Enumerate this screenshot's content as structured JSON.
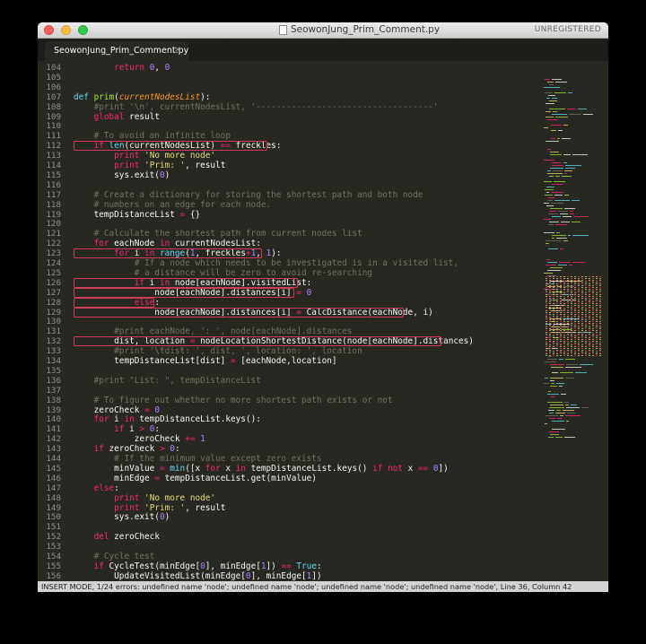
{
  "window": {
    "title": "SeowonJung_Prim_Comment.py",
    "unregistered_label": "UNREGISTERED",
    "tab_label": "SeowonJung_Prim_Comment.py",
    "tab_close_glyph": "×"
  },
  "colors": {
    "background": "#272822",
    "keyword": "#f92672",
    "function": "#a6e22e",
    "string": "#e6db74",
    "number": "#ae81ff",
    "comment": "#75715e",
    "builtin": "#66d9ef",
    "parameter": "#fd971f",
    "error_outline": "#d03a5c"
  },
  "editor": {
    "lines": [
      {
        "n": "104",
        "html": "        <span class='kw'>return</span> <span class='nm'>0</span>, <span class='nm'>0</span>"
      },
      {
        "n": "105",
        "html": ""
      },
      {
        "n": "106",
        "html": ""
      },
      {
        "n": "107",
        "html": "<span class='bi'>def</span> <span class='fn'>prim</span>(<span class='pa'>currentNodesList</span>):"
      },
      {
        "n": "108",
        "html": "    <span class='cm'>#print '\\n', currentNodesList, '-----------------------------------'</span>"
      },
      {
        "n": "109",
        "html": "    <span class='kw'>global</span> result"
      },
      {
        "n": "110",
        "html": ""
      },
      {
        "n": "111",
        "html": "    <span class='cm'># To avoid an infinite loop</span>"
      },
      {
        "n": "112",
        "html": "    <span class='kw'>if</span> <span class='bi'>len</span>(currentNodesList) <span class='kw'>==</span> freckles:"
      },
      {
        "n": "113",
        "html": "        <span class='kw'>print</span> <span class='st'>'No more node'</span>"
      },
      {
        "n": "114",
        "html": "        <span class='kw'>print</span> <span class='st'>'Prim: '</span>, result"
      },
      {
        "n": "115",
        "html": "        sys.exit(<span class='nm'>0</span>)"
      },
      {
        "n": "116",
        "html": ""
      },
      {
        "n": "117",
        "html": "    <span class='cm'># Create a dictionary for storing the shortest path and both node</span>"
      },
      {
        "n": "118",
        "html": "    <span class='cm'># numbers on an edge for each node.</span>"
      },
      {
        "n": "119",
        "html": "    tempDistanceList <span class='kw'>=</span> {}"
      },
      {
        "n": "120",
        "html": ""
      },
      {
        "n": "121",
        "html": "    <span class='cm'># Calculate the shortest path from current nodes list</span>"
      },
      {
        "n": "122",
        "html": "    <span class='kw'>for</span> eachNode <span class='kw'>in</span> currentNodesList:"
      },
      {
        "n": "123",
        "html": "        <span class='kw'>for</span> i <span class='kw'>in</span> <span class='bi'>range</span>(<span class='nm'>1</span>, freckles<span class='kw'>+</span><span class='nm'>1</span>, <span class='nm'>1</span>):"
      },
      {
        "n": "124",
        "html": "            <span class='cm'># If a node which needs to be investigated is in a visited list,</span>"
      },
      {
        "n": "125",
        "html": "            <span class='cm'># a distance will be zero to avoid re-searching</span>"
      },
      {
        "n": "126",
        "html": "            <span class='kw'>if</span> i <span class='kw'>in</span> node[eachNode].visitedList:"
      },
      {
        "n": "127",
        "html": "                node[eachNode].distances[i] <span class='kw'>=</span> <span class='nm'>0</span>"
      },
      {
        "n": "128",
        "html": "            <span class='kw'>else</span>:"
      },
      {
        "n": "129",
        "html": "                node[eachNode].distances[i] <span class='kw'>=</span> CalcDistance(eachNode, i)"
      },
      {
        "n": "130",
        "html": ""
      },
      {
        "n": "131",
        "html": "        <span class='cm'>#print eachNode, ': ', node[eachNode].distances</span>"
      },
      {
        "n": "132",
        "html": "        dist, location <span class='kw'>=</span> nodeLocationShortestDistance(node[eachNode].distances)"
      },
      {
        "n": "133",
        "html": "        <span class='cm'>#print '\\tdist: ', dist, ', location: ', location</span>"
      },
      {
        "n": "134",
        "html": "        tempDistanceList[dist] <span class='kw'>=</span> [eachNode,location]"
      },
      {
        "n": "135",
        "html": ""
      },
      {
        "n": "136",
        "html": "    <span class='cm'>#print \"List: \", tempDistanceList</span>"
      },
      {
        "n": "137",
        "html": ""
      },
      {
        "n": "138",
        "html": "    <span class='cm'># To figure out whether no more shortest path exists or not</span>"
      },
      {
        "n": "139",
        "html": "    zeroCheck <span class='kw'>=</span> <span class='nm'>0</span>"
      },
      {
        "n": "140",
        "html": "    <span class='kw'>for</span> i <span class='kw'>in</span> tempDistanceList.keys():"
      },
      {
        "n": "141",
        "html": "        <span class='kw'>if</span> i <span class='kw'>&gt;</span> <span class='nm'>0</span>:"
      },
      {
        "n": "142",
        "html": "            zeroCheck <span class='kw'>+=</span> <span class='nm'>1</span>"
      },
      {
        "n": "143",
        "html": "    <span class='kw'>if</span> zeroCheck <span class='kw'>&gt;</span> <span class='nm'>0</span>:"
      },
      {
        "n": "144",
        "html": "        <span class='cm'># If the minimum value except zero exists</span>"
      },
      {
        "n": "145",
        "html": "        minValue <span class='kw'>=</span> <span class='bi'>min</span>([x <span class='kw'>for</span> x <span class='kw'>in</span> tempDistanceList.keys() <span class='kw'>if</span> <span class='kw'>not</span> x <span class='kw'>==</span> <span class='nm'>0</span>])"
      },
      {
        "n": "146",
        "html": "        minEdge <span class='kw'>=</span> tempDistanceList.get(minValue)"
      },
      {
        "n": "147",
        "html": "    <span class='kw'>else</span>:"
      },
      {
        "n": "148",
        "html": "        <span class='kw'>print</span> <span class='st'>'No more node'</span>"
      },
      {
        "n": "149",
        "html": "        <span class='kw'>print</span> <span class='st'>'Prim: '</span>, result"
      },
      {
        "n": "150",
        "html": "        sys.exit(<span class='nm'>0</span>)"
      },
      {
        "n": "151",
        "html": ""
      },
      {
        "n": "152",
        "html": "    <span class='kw'>del</span> zeroCheck"
      },
      {
        "n": "153",
        "html": ""
      },
      {
        "n": "154",
        "html": "    <span class='cm'># Cycle test</span>"
      },
      {
        "n": "155",
        "html": "    <span class='kw'>if</span> CycleTest(minEdge[<span class='nm'>0</span>], minEdge[<span class='nm'>1</span>]) <span class='kw'>==</span> <span class='bi'>True</span>:"
      },
      {
        "n": "156",
        "html": "        UpdateVisitedList(minEdge[<span class='nm'>0</span>], minEdge[<span class='nm'>1</span>])"
      }
    ]
  },
  "status_bar": {
    "text": "INSERT MODE, 1/24 errors: undefined name 'node'; undefined name 'node'; undefined name 'node'; undefined name 'node', Line 36, Column 42"
  }
}
